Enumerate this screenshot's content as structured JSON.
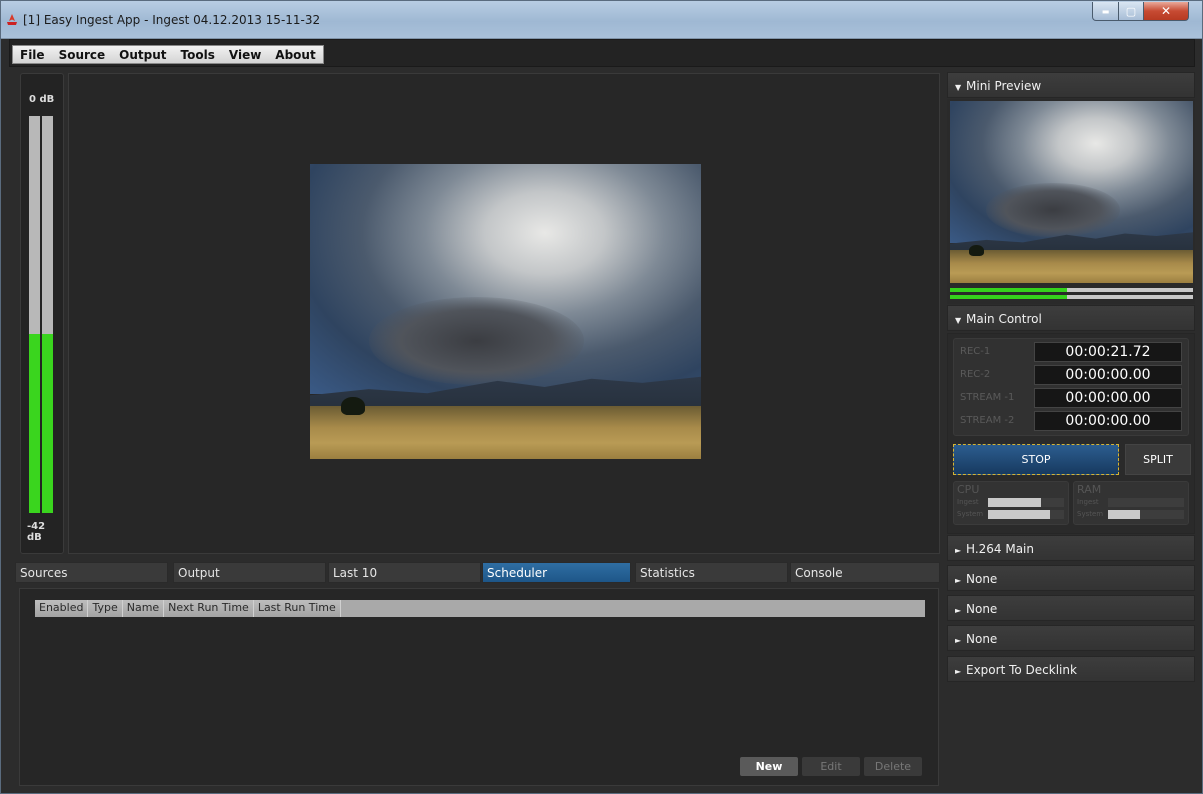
{
  "window": {
    "title": "[1] Easy Ingest App - Ingest 04.12.2013 15-11-32",
    "minimize_glyph": "▬",
    "maximize_glyph": "▢",
    "close_glyph": "✕"
  },
  "menu": [
    "File",
    "Source",
    "Output",
    "Tools",
    "View",
    "About"
  ],
  "audio_meter": {
    "top_label": "0 dB",
    "bottom_label": "-42 dB",
    "left_level": 0.45,
    "right_level": 0.45
  },
  "tabs": [
    {
      "label": "Sources",
      "active": false
    },
    {
      "label": "Output",
      "active": false
    },
    {
      "label": "Last 10",
      "active": false
    },
    {
      "label": "Scheduler",
      "active": true
    },
    {
      "label": "Statistics",
      "active": false
    },
    {
      "label": "Console",
      "active": false
    }
  ],
  "scheduler": {
    "columns": [
      "Enabled",
      "Type",
      "Name",
      "Next Run Time",
      "Last Run Time"
    ],
    "buttons": {
      "new": "New",
      "edit": "Edit",
      "delete": "Delete"
    }
  },
  "sidebar": {
    "mini_preview": {
      "title": "Mini Preview",
      "expanded": true,
      "meter_left_level": 0.48,
      "meter_right_level": 0.48
    },
    "main_control": {
      "title": "Main Control",
      "expanded": true,
      "timers": [
        {
          "label": "REC-1",
          "value": "00:00:21.72"
        },
        {
          "label": "REC-2",
          "value": "00:00:00.00"
        },
        {
          "label": "STREAM -1",
          "value": "00:00:00.00"
        },
        {
          "label": "STREAM -2",
          "value": "00:00:00.00"
        }
      ],
      "stop_label": "STOP",
      "split_label": "SPLIT",
      "cpu": {
        "title": "CPU",
        "ingest_label": "Ingest",
        "system_label": "System",
        "ingest_level": 0.7,
        "system_level": 0.82
      },
      "ram": {
        "title": "RAM",
        "ingest_label": "Ingest",
        "system_label": "System",
        "ingest_level": 0.0,
        "system_level": 0.42
      }
    },
    "collapsed_sections": [
      "H.264 Main",
      "None",
      "None",
      "None",
      "Export To Decklink"
    ]
  },
  "colors": {
    "accent_tab": "#1e5688",
    "meter_green": "#3ad51e",
    "stop_border": "#d8b431"
  }
}
